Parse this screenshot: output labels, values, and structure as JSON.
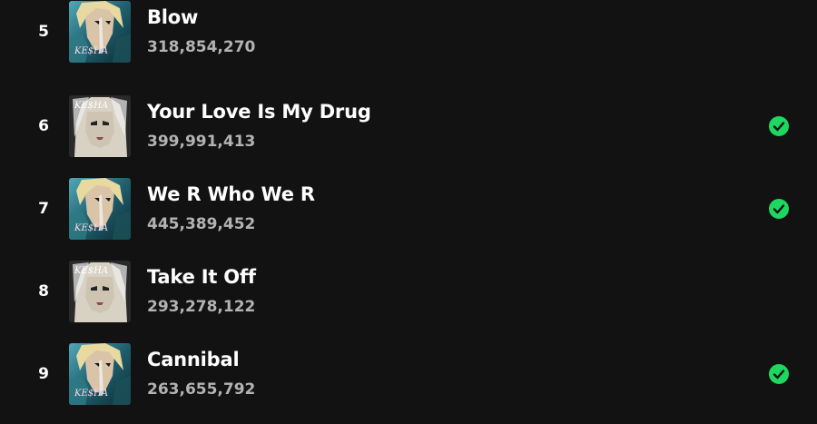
{
  "tracks": [
    {
      "number": "5",
      "title": "Blow",
      "plays": "318,854,270",
      "saved": false,
      "art": "cannibal"
    },
    {
      "number": "6",
      "title": "Your Love Is My Drug",
      "plays": "399,991,413",
      "saved": true,
      "art": "animal"
    },
    {
      "number": "7",
      "title": "We R Who We R",
      "plays": "445,389,452",
      "saved": true,
      "art": "cannibal"
    },
    {
      "number": "8",
      "title": "Take It Off",
      "plays": "293,278,122",
      "saved": false,
      "art": "animal"
    },
    {
      "number": "9",
      "title": "Cannibal",
      "plays": "263,655,792",
      "saved": true,
      "art": "cannibal"
    }
  ],
  "art_logo_text": "KE$HA",
  "colors": {
    "background": "#121212",
    "accent": "#1ed760",
    "secondary_text": "#b3b3b3"
  },
  "icons": {
    "saved": "check-circle-icon"
  }
}
